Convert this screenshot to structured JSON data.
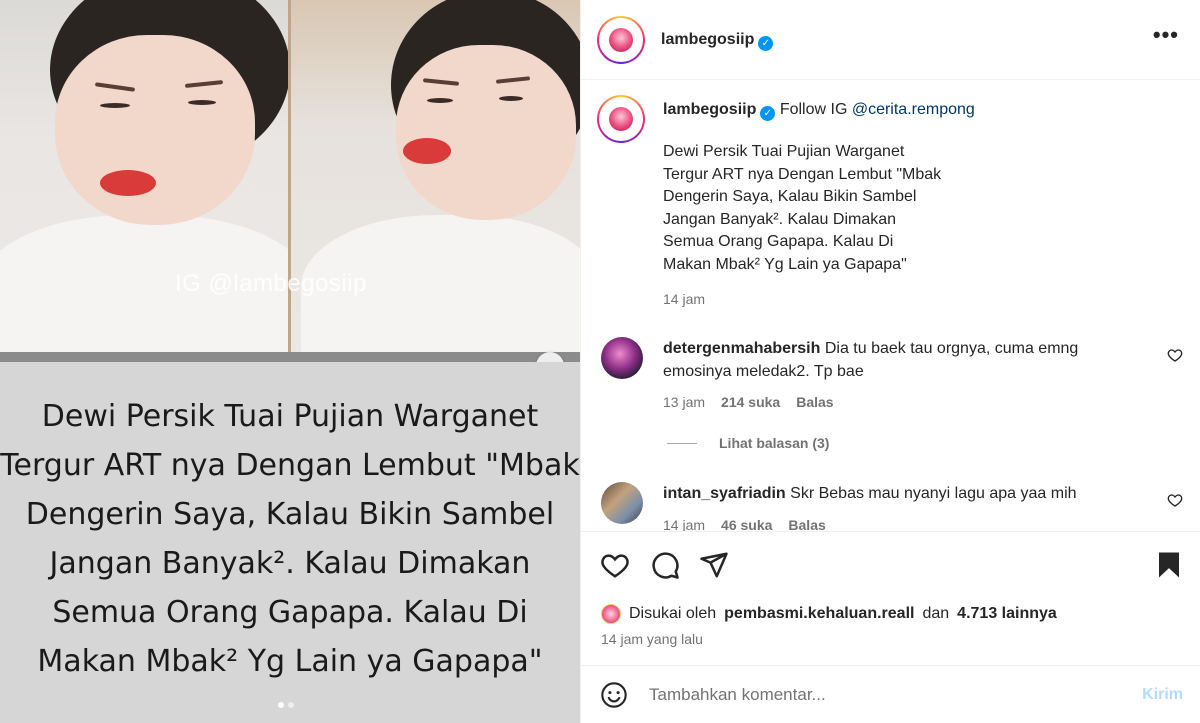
{
  "media": {
    "watermark": "IG @lambegosiip",
    "caption_lines": [
      "Dewi Persik Tuai Pujian Warganet",
      "Tergur ART nya Dengan Lembut \"Mbak",
      "Dengerin Saya, Kalau Bikin Sambel",
      "Jangan Banyak². Kalau Dimakan",
      "Semua Orang Gapapa.  Kalau Di",
      "Makan Mbak² Yg Lain ya Gapapa\""
    ],
    "next_icon": "chevron-right-icon",
    "carousel_pages": 2,
    "carousel_active": 1
  },
  "header": {
    "username": "lambegosiip",
    "more_label": "•••"
  },
  "caption": {
    "username": "lambegosiip",
    "prefix": "Follow IG ",
    "mention": "@cerita.rempong",
    "lines": [
      "Dewi Persik Tuai Pujian Warganet",
      "Tergur ART nya Dengan Lembut \"Mbak",
      "Dengerin Saya, Kalau Bikin Sambel",
      "Jangan Banyak². Kalau Dimakan",
      "Semua Orang Gapapa. Kalau Di",
      "Makan Mbak² Yg Lain ya Gapapa\""
    ],
    "time": "14 jam"
  },
  "comments": [
    {
      "username": "detergenmahabersih",
      "text": "Dia tu baek tau orgnya, cuma emng emosinya meledak2. Tp bae",
      "time": "13 jam",
      "likes": "214 suka",
      "reply": "Balas"
    },
    {
      "username": "intan_syafriadin",
      "text": "Skr Bebas mau nyanyi lagu apa yaa mih",
      "time": "14 jam",
      "likes": "46 suka",
      "reply": "Balas"
    }
  ],
  "view_replies": "Lihat balasan (3)",
  "likes": {
    "prefix": "Disukai oleh",
    "user": "pembasmi.kehaluan.reall",
    "connector": "dan",
    "others": "4.713 lainnya"
  },
  "post_time": "14 jam yang lalu",
  "add_comment": {
    "placeholder": "Tambahkan komentar...",
    "post_label": "Kirim"
  },
  "colors": {
    "verified": "#0095f6",
    "link": "#00376b",
    "muted": "#737373",
    "post_disabled": "#b3dbff"
  }
}
